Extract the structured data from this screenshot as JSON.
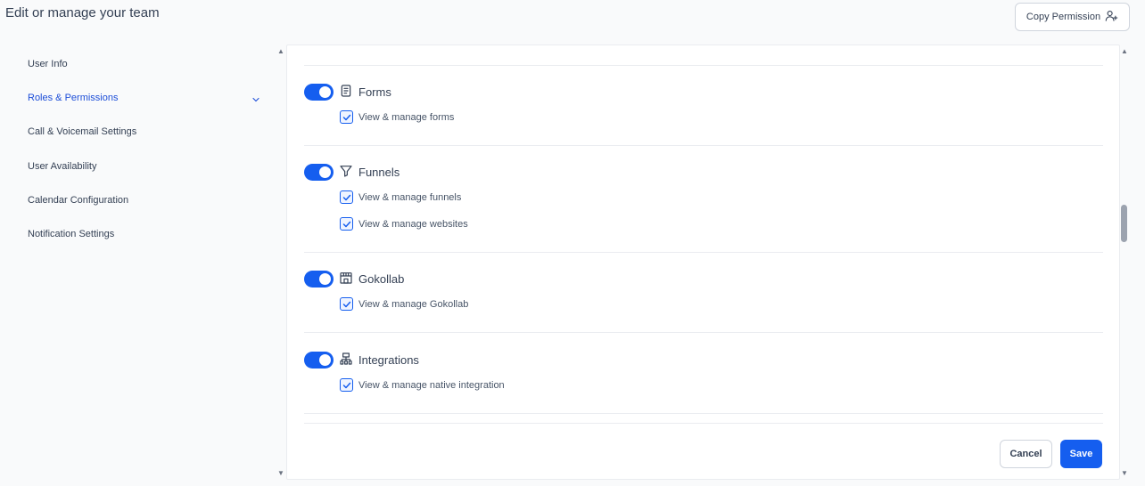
{
  "header": {
    "title": "Edit or manage your team",
    "copy_permission_label": "Copy Permission",
    "copy_permission_icon": "user-plus-icon"
  },
  "sidebar": {
    "items": [
      {
        "label": "User Info"
      },
      {
        "label": "Roles & Permissions",
        "active": true
      },
      {
        "label": "Call & Voicemail Settings"
      },
      {
        "label": "User Availability"
      },
      {
        "label": "Calendar Configuration"
      },
      {
        "label": "Notification Settings"
      }
    ],
    "chevron_icon": "chevron-down-icon"
  },
  "sections": [
    {
      "title": "Forms",
      "icon": "form-document-icon",
      "enabled": true,
      "permissions": [
        {
          "label": "View & manage forms",
          "checked": true
        }
      ]
    },
    {
      "title": "Funnels",
      "icon": "funnel-filter-icon",
      "enabled": true,
      "permissions": [
        {
          "label": "View & manage funnels",
          "checked": true
        },
        {
          "label": "View & manage websites",
          "checked": true
        }
      ]
    },
    {
      "title": "Gokollab",
      "icon": "storefront-icon",
      "enabled": true,
      "permissions": [
        {
          "label": "View & manage Gokollab",
          "checked": true
        }
      ]
    },
    {
      "title": "Integrations",
      "icon": "sitemap-icon",
      "enabled": true,
      "permissions": [
        {
          "label": "View & manage native integration",
          "checked": true
        }
      ]
    }
  ],
  "footer": {
    "cancel_label": "Cancel",
    "save_label": "Save"
  },
  "colors": {
    "accent": "#155eef",
    "active_link": "#1d4ed8"
  }
}
